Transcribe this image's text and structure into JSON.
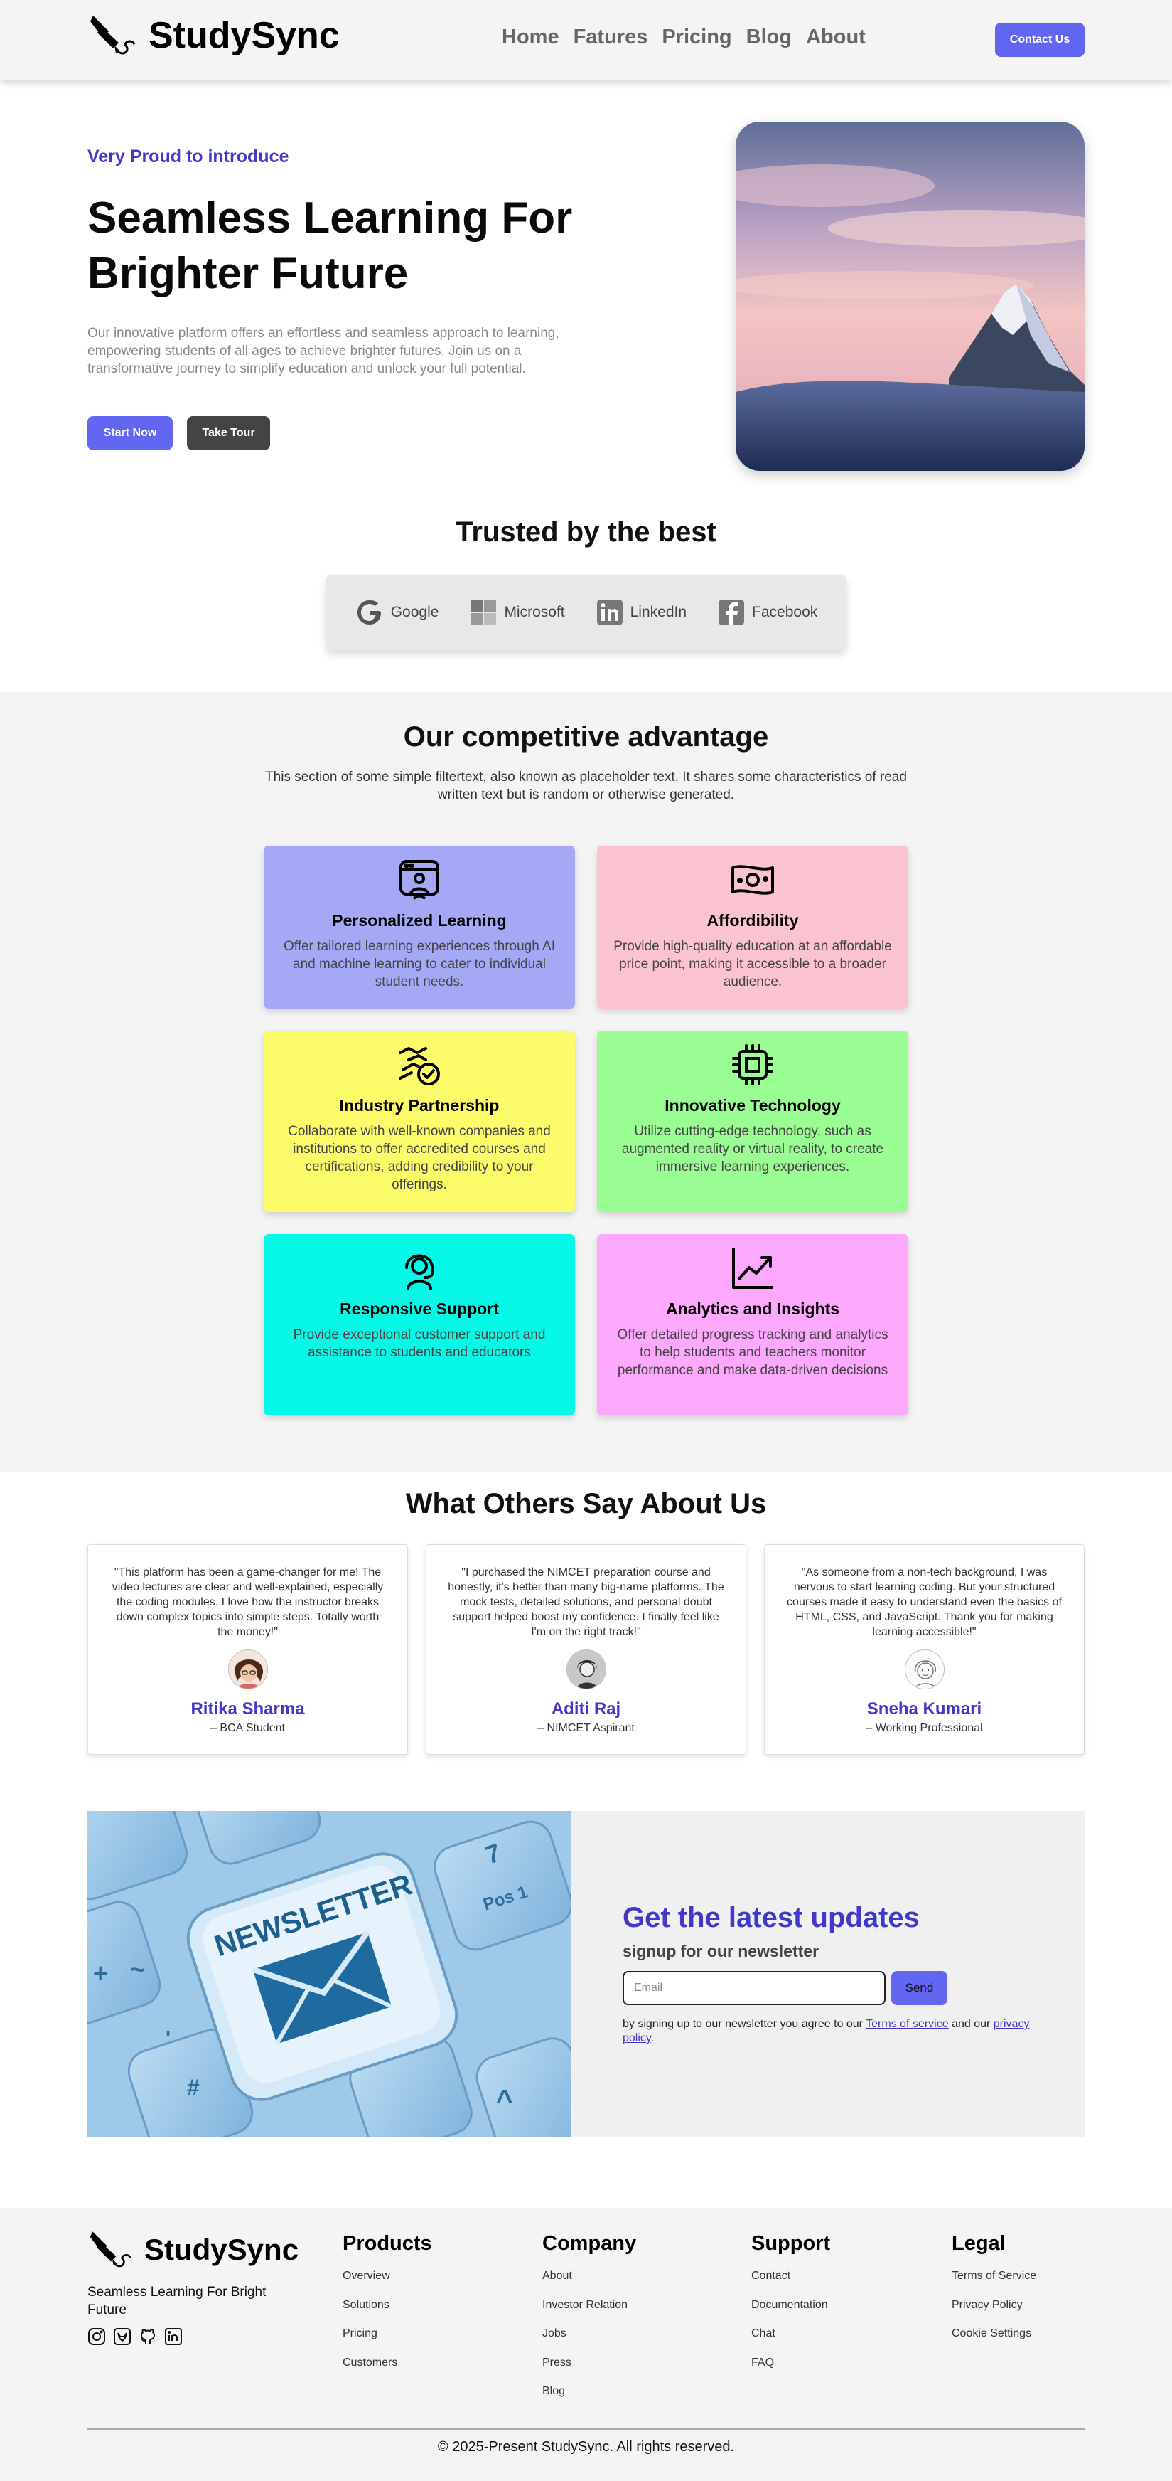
{
  "brand": {
    "name": "StudySync"
  },
  "nav": {
    "links": [
      "Home",
      "Fatures",
      "Pricing",
      "Blog",
      "About"
    ],
    "contact_label": "Contact Us"
  },
  "hero": {
    "intro": "Very Proud to introduce",
    "title": "Seamless Learning For Brighter Future",
    "description": "Our innovative platform offers an effortless and seamless approach to learning, empowering students of all ages to achieve brighter futures. Join us on a transformative journey to simplify education and unlock your full potential.",
    "start_label": "Start Now",
    "tour_label": "Take Tour"
  },
  "trusted": {
    "title": "Trusted by the best",
    "brands": [
      {
        "name": "Google",
        "icon": "google-icon"
      },
      {
        "name": "Microsoft",
        "icon": "microsoft-icon"
      },
      {
        "name": "LinkedIn",
        "icon": "linkedin-icon"
      },
      {
        "name": "Facebook",
        "icon": "facebook-icon"
      }
    ]
  },
  "advantage": {
    "title": "Our competitive advantage",
    "description": "This section of some simple filtertext, also known as placeholder text. It shares some characteristics of read written text but is random or otherwise generated.",
    "cards": [
      {
        "title": "Personalized Learning",
        "text": "Offer tailored learning experiences through AI and machine learning to cater to individual student needs.",
        "color": "#a5a8f5",
        "icon": "personalized-learning-icon"
      },
      {
        "title": "Affordibility",
        "text": "Provide high-quality education at an affordable price point, making it accessible to a broader audience.",
        "color": "#fbc3cf",
        "icon": "money-icon"
      },
      {
        "title": "Industry Partnership",
        "text": "Collaborate with well-known companies and institutions to offer accredited courses and certifications, adding credibility to your offerings.",
        "color": "#fcfc6a",
        "icon": "handshake-check-icon"
      },
      {
        "title": "Innovative Technology",
        "text": "Utilize cutting-edge technology, such as augmented reality or virtual reality, to create immersive learning experiences.",
        "color": "#99fd94",
        "icon": "chip-icon"
      },
      {
        "title": "Responsive Support",
        "text": "Provide exceptional customer support and assistance to students and educators",
        "color": "#06f9e6",
        "icon": "support-agent-icon"
      },
      {
        "title": "Analytics and Insights",
        "text": "Offer detailed progress tracking and analytics to help students and teachers monitor performance and make data-driven decisions",
        "color": "#fca8fc",
        "icon": "chart-line-icon"
      }
    ]
  },
  "testimonials": {
    "title": "What Others Say About Us",
    "items": [
      {
        "quote": "\"This platform has been a game-changer for me! The video lectures are clear and well-explained, especially the coding modules. I love how the instructor breaks down complex topics into simple steps. Totally worth the money!\"",
        "name": "Ritika Sharma",
        "role": "– BCA Student"
      },
      {
        "quote": "\"I purchased the NIMCET preparation course and honestly, it's better than many big-name platforms. The mock tests, detailed solutions, and personal doubt support helped boost my confidence. I finally feel like I'm on the right track!\"",
        "name": "Aditi Raj",
        "role": "– NIMCET Aspirant"
      },
      {
        "quote": "\"As someone from a non-tech background, I was nervous to start learning coding. But your structured courses made it easy to understand even the basics of HTML, CSS, and JavaScript. Thank you for making learning accessible!\"",
        "name": "Sneha Kumari",
        "role": "– Working Professional"
      }
    ]
  },
  "newsletter": {
    "image_text": "NEWSLETTER",
    "title": "Get the latest updates",
    "subtitle": "signup for our newsletter",
    "email_placeholder": "Email",
    "send_label": "Send",
    "note_prefix": "by signing up to our newsletter you agree to our ",
    "terms_label": "Terms of service",
    "note_middle": " and our ",
    "privacy_label": "privacy policy",
    "note_suffix": "."
  },
  "footer": {
    "tagline": "Seamless Learning For Bright Future",
    "socials": [
      "instagram-icon",
      "gitlab-icon",
      "github-icon",
      "linkedin-icon"
    ],
    "columns": [
      {
        "title": "Products",
        "links": [
          "Overview",
          "Solutions",
          "Pricing",
          "Customers"
        ]
      },
      {
        "title": "Company",
        "links": [
          "About",
          "Investor Relation",
          "Jobs",
          "Press",
          "Blog"
        ]
      },
      {
        "title": "Support",
        "links": [
          "Contact",
          "Documentation",
          "Chat",
          "FAQ"
        ]
      },
      {
        "title": "Legal",
        "links": [
          "Terms of Service",
          "Privacy Policy",
          "Cookie Settings"
        ]
      }
    ],
    "copyright": "© 2025-Present StudySync. All rights reserved."
  }
}
